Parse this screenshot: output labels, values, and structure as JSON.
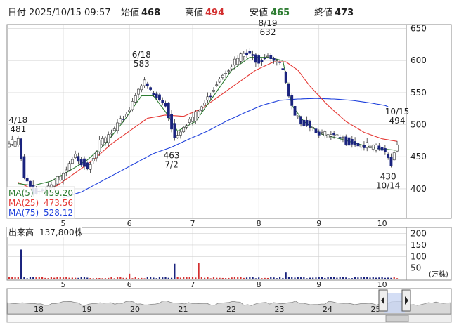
{
  "header": {
    "date_label": "日付",
    "date_value": "2025/10/15 09:57",
    "open_label": "始値",
    "open_value": "468",
    "high_label": "高値",
    "high_value": "494",
    "low_label": "安値",
    "low_value": "465",
    "close_label": "終値",
    "close_value": "473"
  },
  "legend": [
    {
      "name": "MA(5)",
      "value": "459.20",
      "color": "#2e7d32"
    },
    {
      "name": "MA(25)",
      "value": "473.56",
      "color": "#e53935"
    },
    {
      "name": "MA(75)",
      "value": "528.12",
      "color": "#1e40dc"
    }
  ],
  "volume_header": {
    "label": "出来高",
    "value": "137,800株"
  },
  "volume_unit": "(万株)",
  "colors": {
    "up": "#1a237e",
    "down": "#d32f2f",
    "grid": "#d0d0d0",
    "frame": "#888888"
  },
  "chart_data": [
    {
      "type": "candlestick",
      "y_ticks": [
        400,
        450,
        500,
        550,
        600,
        650
      ],
      "ylim": [
        355,
        655
      ],
      "x_month_labels": [
        "5",
        "6",
        "7",
        "8",
        "9",
        "10"
      ],
      "x_month_positions": [
        18,
        40,
        61,
        83,
        103,
        124
      ],
      "num_days": 130,
      "close_anchors": [
        [
          0,
          470
        ],
        [
          3,
          475
        ],
        [
          5,
          415
        ],
        [
          8,
          395
        ],
        [
          10,
          395
        ],
        [
          18,
          420
        ],
        [
          22,
          450
        ],
        [
          26,
          435
        ],
        [
          30,
          470
        ],
        [
          35,
          490
        ],
        [
          40,
          525
        ],
        [
          43,
          560
        ],
        [
          45,
          565
        ],
        [
          48,
          545
        ],
        [
          52,
          530
        ],
        [
          55,
          480
        ],
        [
          58,
          500
        ],
        [
          62,
          515
        ],
        [
          66,
          540
        ],
        [
          70,
          575
        ],
        [
          74,
          595
        ],
        [
          78,
          610
        ],
        [
          81,
          605
        ],
        [
          83,
          600
        ],
        [
          86,
          610
        ],
        [
          89,
          600
        ],
        [
          91,
          585
        ],
        [
          93,
          540
        ],
        [
          95,
          510
        ],
        [
          100,
          500
        ],
        [
          104,
          485
        ],
        [
          108,
          480
        ],
        [
          112,
          475
        ],
        [
          116,
          470
        ],
        [
          120,
          465
        ],
        [
          124,
          460
        ],
        [
          127,
          440
        ],
        [
          129,
          473
        ]
      ],
      "ma_start": {
        "ma5": 3,
        "ma25": 3,
        "ma75": 18
      },
      "ma_anchors": {
        "ma5": [
          [
            3,
            408
          ],
          [
            8,
            405
          ],
          [
            14,
            412
          ],
          [
            20,
            428
          ],
          [
            26,
            445
          ],
          [
            32,
            470
          ],
          [
            38,
            505
          ],
          [
            44,
            545
          ],
          [
            48,
            545
          ],
          [
            52,
            520
          ],
          [
            56,
            490
          ],
          [
            62,
            505
          ],
          [
            68,
            545
          ],
          [
            74,
            585
          ],
          [
            80,
            605
          ],
          [
            86,
            605
          ],
          [
            91,
            600
          ],
          [
            94,
            530
          ],
          [
            98,
            505
          ],
          [
            104,
            485
          ],
          [
            110,
            478
          ],
          [
            116,
            470
          ],
          [
            122,
            463
          ],
          [
            129,
            460
          ]
        ],
        "ma25": [
          [
            3,
            410
          ],
          [
            10,
            395
          ],
          [
            16,
            405
          ],
          [
            22,
            425
          ],
          [
            28,
            445
          ],
          [
            34,
            470
          ],
          [
            40,
            490
          ],
          [
            46,
            510
          ],
          [
            52,
            515
          ],
          [
            58,
            513
          ],
          [
            64,
            525
          ],
          [
            70,
            545
          ],
          [
            76,
            565
          ],
          [
            82,
            585
          ],
          [
            88,
            598
          ],
          [
            92,
            598
          ],
          [
            96,
            585
          ],
          [
            100,
            560
          ],
          [
            106,
            530
          ],
          [
            112,
            505
          ],
          [
            118,
            488
          ],
          [
            124,
            478
          ],
          [
            129,
            474
          ]
        ],
        "ma75": [
          [
            18,
            386
          ],
          [
            24,
            395
          ],
          [
            30,
            410
          ],
          [
            36,
            425
          ],
          [
            42,
            440
          ],
          [
            48,
            455
          ],
          [
            54,
            465
          ],
          [
            60,
            478
          ],
          [
            66,
            490
          ],
          [
            72,
            505
          ],
          [
            78,
            518
          ],
          [
            84,
            530
          ],
          [
            90,
            538
          ],
          [
            96,
            540
          ],
          [
            102,
            541
          ],
          [
            108,
            540
          ],
          [
            114,
            538
          ],
          [
            120,
            534
          ],
          [
            125,
            530
          ],
          [
            126,
            528
          ]
        ]
      },
      "annotations": [
        {
          "day": 3,
          "value": 481,
          "label": "481",
          "date": "4/18",
          "anchor": "above"
        },
        {
          "day": 44,
          "value": 583,
          "label": "583",
          "date": "6/18",
          "anchor": "above"
        },
        {
          "day": 54,
          "value": 463,
          "label": "463",
          "date": "7/2",
          "anchor": "below"
        },
        {
          "day": 86,
          "value": 632,
          "label": "632",
          "date": "8/19",
          "anchor": "above"
        },
        {
          "day": 126,
          "value": 430,
          "label": "430",
          "date": "10/14",
          "anchor": "below"
        },
        {
          "day": 129,
          "value": 494,
          "label": "494",
          "date": "10/15",
          "anchor": "above"
        }
      ]
    },
    {
      "type": "bar",
      "name": "volume",
      "unit": "(万株)",
      "y_ticks": [
        50,
        100,
        150,
        200
      ],
      "ylim": [
        0,
        220
      ],
      "spikes": [
        {
          "day": 4,
          "value": 130
        },
        {
          "day": 55,
          "value": 68
        },
        {
          "day": 63,
          "value": 72
        },
        {
          "day": 40,
          "value": 25
        },
        {
          "day": 92,
          "value": 30
        }
      ],
      "base_volume": 8
    },
    {
      "type": "area",
      "name": "navigator",
      "x_labels": [
        "18",
        "19",
        "20",
        "21",
        "22",
        "23",
        "24",
        "25"
      ]
    }
  ]
}
